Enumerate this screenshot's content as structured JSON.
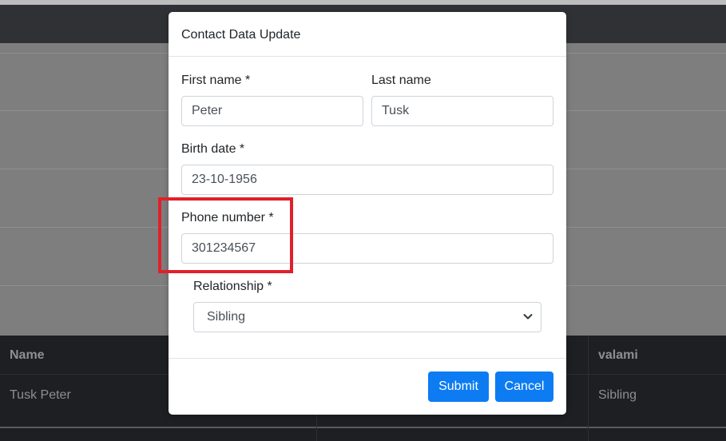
{
  "background": {
    "table": {
      "headers": [
        "Name",
        "valami"
      ],
      "row": [
        "Tusk Peter",
        "Sibling"
      ]
    }
  },
  "modal": {
    "title": "Contact Data Update",
    "fields": {
      "first_name": {
        "label": "First name *",
        "value": "Peter"
      },
      "last_name": {
        "label": "Last name",
        "value": "Tusk"
      },
      "birth_date": {
        "label": "Birth date *",
        "value": "23-10-1956"
      },
      "phone": {
        "label": "Phone number *",
        "value": "301234567"
      },
      "relationship": {
        "label": "Relationship *",
        "value": "Sibling"
      }
    },
    "buttons": {
      "submit": "Submit",
      "cancel": "Cancel"
    }
  },
  "colors": {
    "primary": "#0d7cf2",
    "highlight": "#e0202a"
  }
}
